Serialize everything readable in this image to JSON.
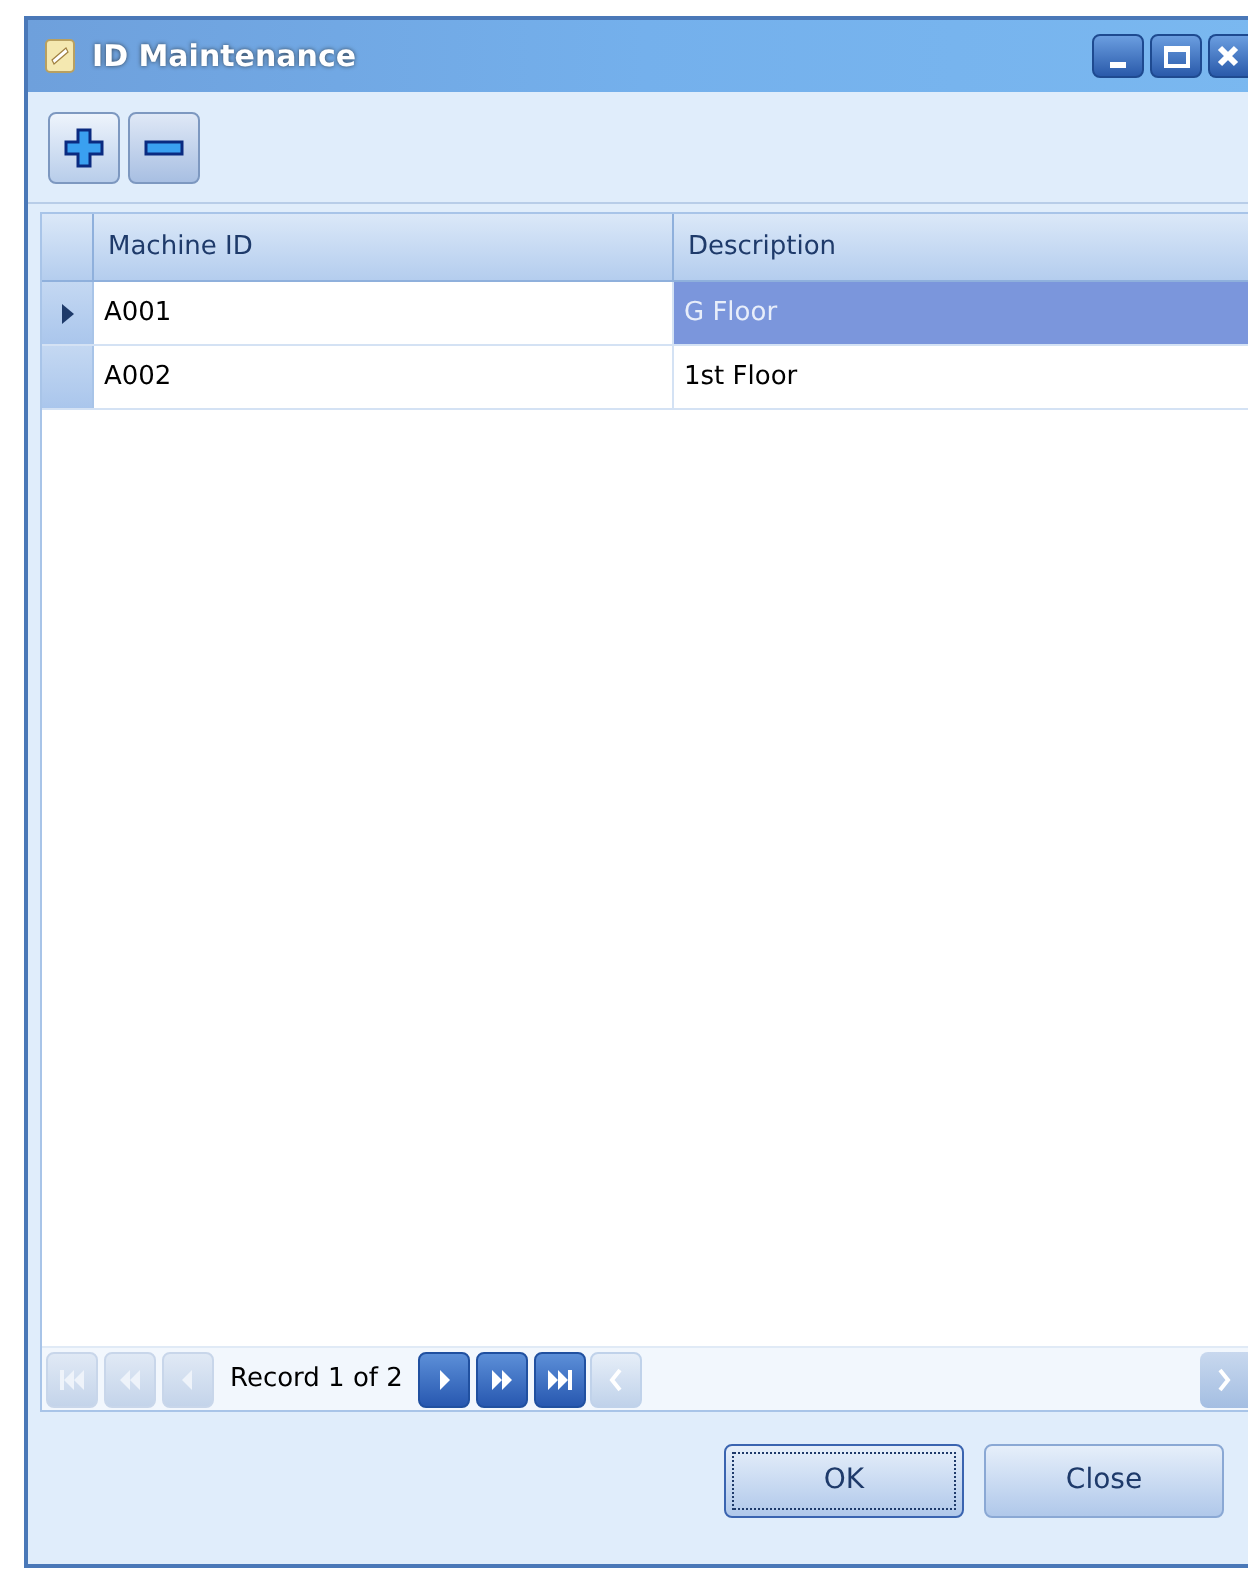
{
  "window": {
    "title": "ID Maintenance"
  },
  "grid": {
    "columns": [
      "Machine ID",
      "Description"
    ],
    "rows": [
      {
        "cells": [
          "A001",
          "G Floor"
        ],
        "selected": true
      },
      {
        "cells": [
          "A002",
          "1st Floor"
        ],
        "selected": false
      }
    ]
  },
  "navigator": {
    "buttons": [
      {
        "kind": "first",
        "disabled": true
      },
      {
        "kind": "prev-page",
        "disabled": true
      },
      {
        "kind": "prev",
        "disabled": true
      },
      {
        "kind": "next",
        "disabled": false
      },
      {
        "kind": "next-page",
        "disabled": false
      },
      {
        "kind": "last",
        "disabled": false
      }
    ],
    "record_text": "Record 1 of 2"
  },
  "buttons": [
    {
      "label": "OK",
      "focused": true
    },
    {
      "label": "Close",
      "focused": false
    }
  ]
}
